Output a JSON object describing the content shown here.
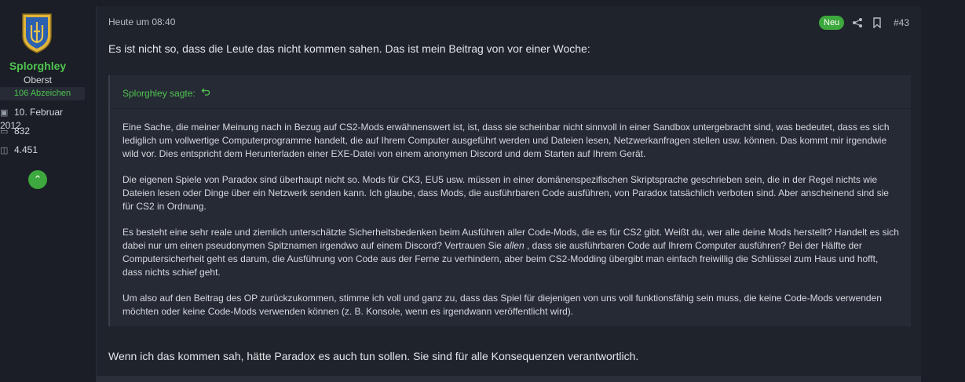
{
  "user": {
    "name": "Splorghley",
    "rank": "Oberst",
    "badges": "106 Abzeichen",
    "joined": "10. Februar 2012",
    "messages": "832",
    "reactions": "4.451",
    "accent": "#4fc34f"
  },
  "post": {
    "date": "Heute um 08:40",
    "new_label": "Neu",
    "number": "#43",
    "intro": "Es ist nicht so, dass die Leute das nicht kommen sahen. Das ist mein Beitrag von vor einer Woche:",
    "quote": {
      "author": "Splorghley sagte:",
      "p1": "Eine Sache, die meiner Meinung nach in Bezug auf CS2-Mods erwähnenswert ist, ist, dass sie scheinbar nicht sinnvoll in einer Sandbox untergebracht sind, was bedeutet, dass es sich lediglich um vollwertige Computerprogramme handelt, die auf Ihrem Computer ausgeführt werden und Dateien lesen, Netzwerkanfragen stellen usw. können. Das kommt mir irgendwie wild vor. Dies entspricht dem Herunterladen einer EXE-Datei von einem anonymen Discord und dem Starten auf Ihrem Gerät.",
      "p2": "Die eigenen Spiele von Paradox sind überhaupt nicht so. Mods für CK3, EU5 usw. müssen in einer domänenspezifischen Skriptsprache geschrieben sein, die in der Regel nichts wie Dateien lesen oder Dinge über ein Netzwerk senden kann. Ich glaube, dass Mods, die ausführbaren Code ausführen, von Paradox tatsächlich verboten sind. Aber anscheinend sind sie für CS2 in Ordnung.",
      "p3a": "Es besteht eine sehr reale und ziemlich unterschätzte Sicherheitsbedenken beim Ausführen aller Code-Mods, die es für CS2 gibt. Weißt du, wer alle deine Mods herstellt? Handelt es sich dabei nur um einen pseudonymen Spitznamen irgendwo auf einem Discord? Vertrauen Sie ",
      "p3em": "allen",
      "p3b": " , dass sie ausführbaren Code auf Ihrem Computer ausführen? Bei der Hälfte der Computersicherheit geht es darum, die Ausführung von Code aus der Ferne zu verhindern, aber beim CS2-Modding übergibt man einfach freiwillig die Schlüssel zum Haus und hofft, dass nichts schief geht.",
      "p4": "Um also auf den Beitrag des OP zurückzukommen, stimme ich voll und ganz zu, dass das Spiel für diejenigen von uns voll funktionsfähig sein muss, die keine Code-Mods verwenden möchten oder keine Code-Mods verwenden können (z. B. Konsole, wenn es irgendwann veröffentlicht wird)."
    },
    "outro": "Wenn ich das kommen sah, hätte Paradox es auch tun sollen. Sie sind für alle Konsequenzen verantwortlich."
  },
  "icons": {
    "joined": "calendar-icon",
    "messages": "messages-icon",
    "reactions": "thumbs-up-icon",
    "scroll": "chevron-up-icon",
    "share": "share-icon",
    "bookmark": "bookmark-icon",
    "quote_link": "go-to-quote-icon"
  }
}
